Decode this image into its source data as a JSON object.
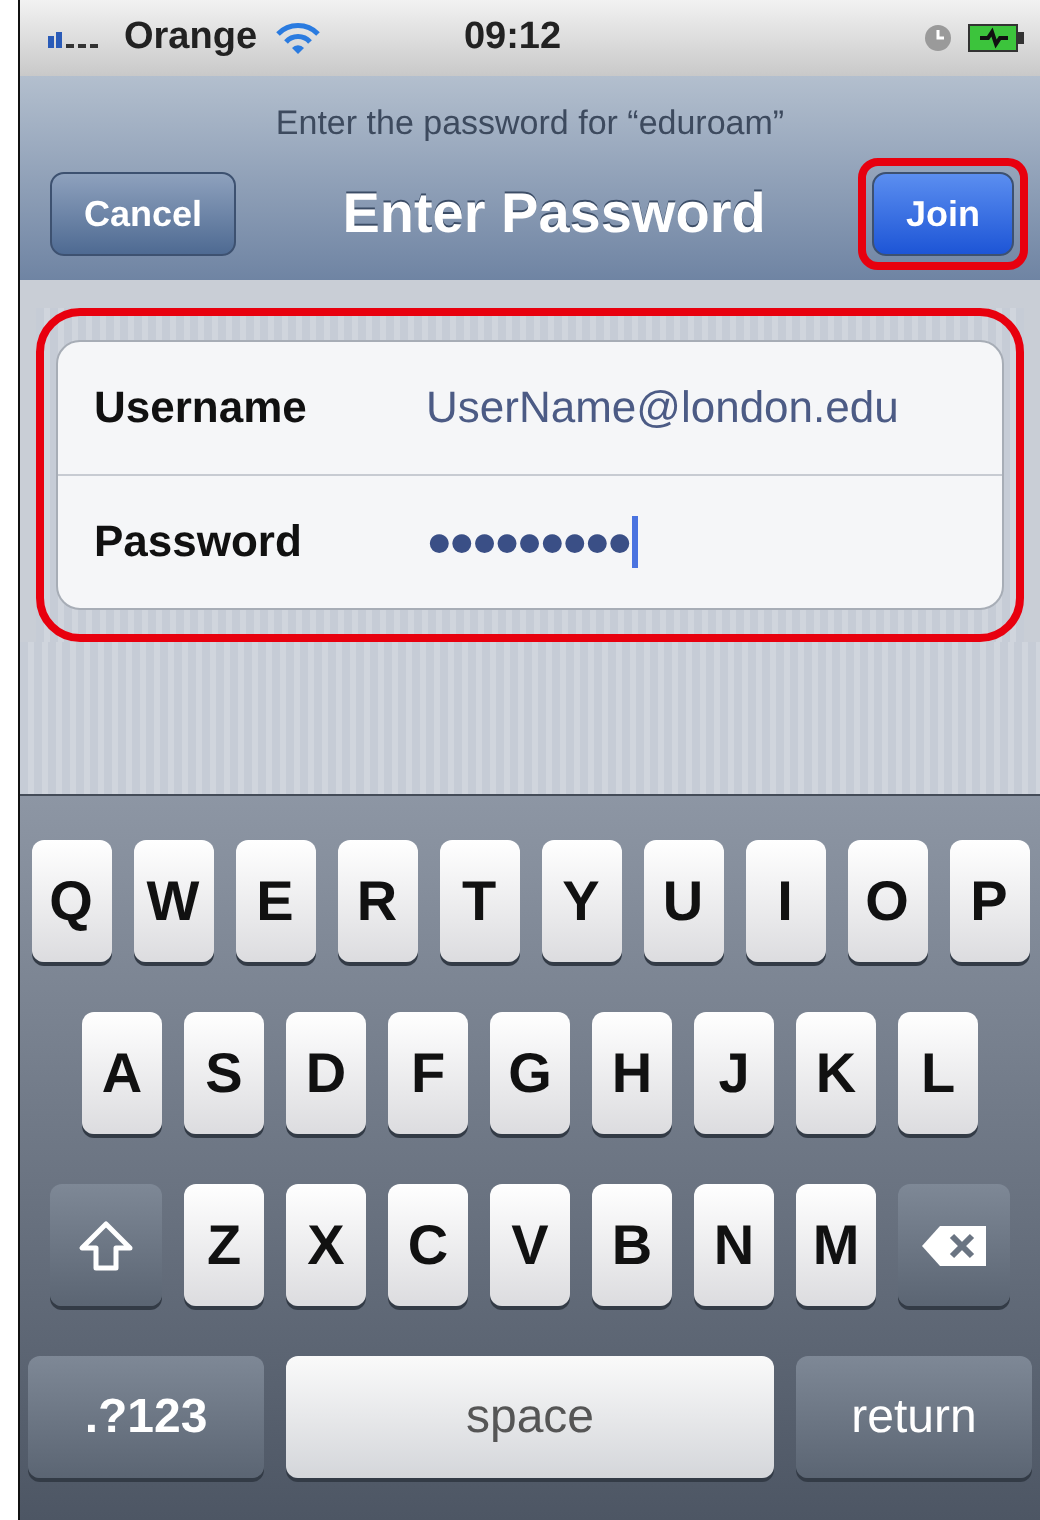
{
  "status_bar": {
    "carrier": "Orange",
    "time": "09:12"
  },
  "prompt": "Enter the password for “eduroam”",
  "nav": {
    "title": "Enter Password",
    "left_button": {
      "label": "Cancel"
    },
    "right_button": {
      "label": "Join",
      "highlighted": true
    }
  },
  "form": {
    "highlighted": true,
    "fields": [
      {
        "label": "Username",
        "value": "UserName@london.edu",
        "secure": false,
        "focused": false
      },
      {
        "label": "Password",
        "value": "●●●●●●●●●",
        "secure": true,
        "focused": true
      }
    ]
  },
  "keyboard": {
    "rows": [
      {
        "keys": [
          {
            "kind": "letter",
            "label": "Q"
          },
          {
            "kind": "letter",
            "label": "W"
          },
          {
            "kind": "letter",
            "label": "E"
          },
          {
            "kind": "letter",
            "label": "R"
          },
          {
            "kind": "letter",
            "label": "T"
          },
          {
            "kind": "letter",
            "label": "Y"
          },
          {
            "kind": "letter",
            "label": "U"
          },
          {
            "kind": "letter",
            "label": "I"
          },
          {
            "kind": "letter",
            "label": "O"
          },
          {
            "kind": "letter",
            "label": "P"
          }
        ]
      },
      {
        "keys": [
          {
            "kind": "letter",
            "label": "A"
          },
          {
            "kind": "letter",
            "label": "S"
          },
          {
            "kind": "letter",
            "label": "D"
          },
          {
            "kind": "letter",
            "label": "F"
          },
          {
            "kind": "letter",
            "label": "G"
          },
          {
            "kind": "letter",
            "label": "H"
          },
          {
            "kind": "letter",
            "label": "J"
          },
          {
            "kind": "letter",
            "label": "K"
          },
          {
            "kind": "letter",
            "label": "L"
          }
        ]
      },
      {
        "keys": [
          {
            "kind": "shift"
          },
          {
            "kind": "letter",
            "label": "Z"
          },
          {
            "kind": "letter",
            "label": "X"
          },
          {
            "kind": "letter",
            "label": "C"
          },
          {
            "kind": "letter",
            "label": "V"
          },
          {
            "kind": "letter",
            "label": "B"
          },
          {
            "kind": "letter",
            "label": "N"
          },
          {
            "kind": "letter",
            "label": "M"
          },
          {
            "kind": "delete"
          }
        ]
      }
    ],
    "bottom_row": {
      "mode_key": ".?123",
      "space_key": "space",
      "return_key": "return"
    }
  }
}
